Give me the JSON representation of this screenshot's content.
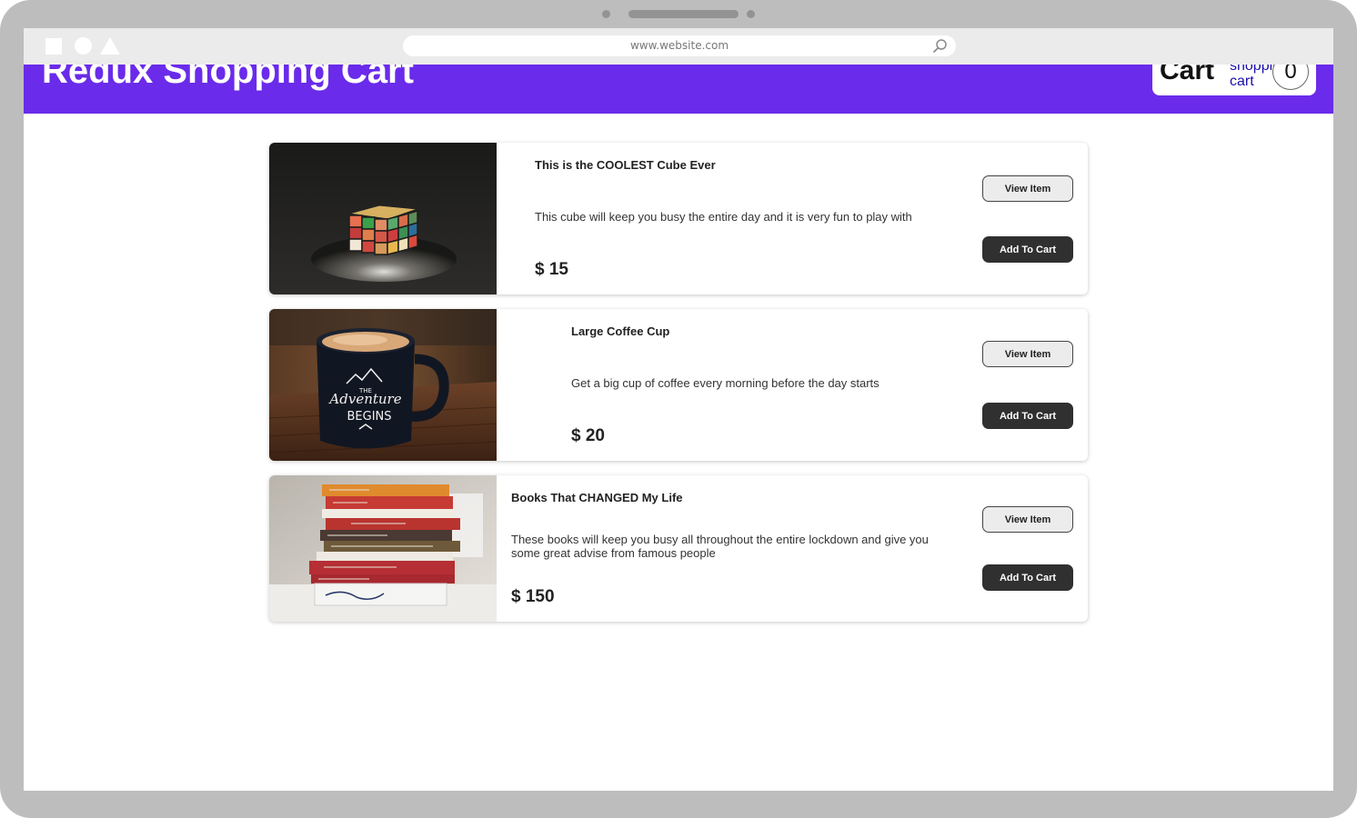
{
  "browser": {
    "url": "www.website.com"
  },
  "header": {
    "title": "Redux Shopping Cart",
    "cart_label": "Cart",
    "cart_icon_alt": "shopping cart",
    "cart_count": "0"
  },
  "colors": {
    "header_bg": "#6a2bea",
    "button_dark": "#303030"
  },
  "products": [
    {
      "name": "This is the COOLEST Cube Ever",
      "description": "This cube will keep you busy the entire day and it is very fun to play with",
      "price": "$ 15",
      "view_label": "View Item",
      "add_label": "Add To Cart",
      "image": "rubiks-cube-photo"
    },
    {
      "name": "Large Coffee Cup",
      "description": "Get a big cup of coffee every morning before the day starts",
      "price": "$ 20",
      "view_label": "View Item",
      "add_label": "Add To Cart",
      "image": "coffee-mug-photo",
      "mug_text": [
        "THE",
        "Adventure",
        "BEGINS"
      ]
    },
    {
      "name": "Books That CHANGED My Life",
      "description": "These books will keep you busy all throughout the entire lockdown and give you some great advise from famous people",
      "price": "$ 150",
      "view_label": "View Item",
      "add_label": "Add To Cart",
      "image": "book-stack-photo"
    }
  ]
}
